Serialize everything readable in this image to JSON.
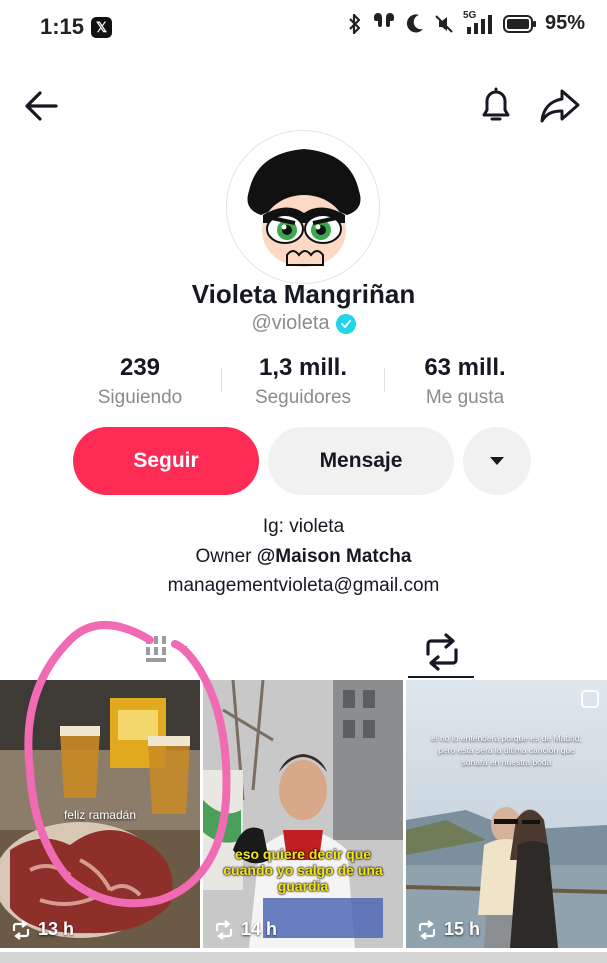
{
  "status_bar": {
    "time": "1:15",
    "network": "5G",
    "battery": "95%"
  },
  "nav": {
    "back_icon": "arrow-left-icon",
    "bell_icon": "bell-icon",
    "share_icon": "share-arrow-icon"
  },
  "profile": {
    "display_name": "Violeta Mangriñan",
    "handle": "@violeta",
    "verified": true,
    "stats": [
      {
        "value": "239",
        "label": "Siguiendo"
      },
      {
        "value": "1,3 mill.",
        "label": "Seguidores"
      },
      {
        "value": "63 mill.",
        "label": "Me gusta"
      }
    ]
  },
  "actions": {
    "follow_label": "Seguir",
    "message_label": "Mensaje",
    "more_icon": "caret-down-icon"
  },
  "bio": {
    "line1": "Ig: violeta",
    "line2_prefix": "Owner ",
    "line2_bold": "@Maison Matcha",
    "line3": "managementvioleta@gmail.com"
  },
  "tabs": {
    "videos_icon": "grid-icon",
    "reposts_icon": "repost-icon",
    "active": "reposts"
  },
  "videos": [
    {
      "caption": "feliz ramadán",
      "count": "13 h"
    },
    {
      "caption": "eso quiere decir que cuando yo salgo de una guardia",
      "count": "14 h"
    },
    {
      "caption": "él no lo entenderá porque es de Madrid, pero esta será la última canción que sonará en nuestra boda",
      "count": "15 h"
    }
  ],
  "colors": {
    "accent": "#fe2c55",
    "verified": "#20d5ec",
    "annotation": "#f06ab4"
  }
}
